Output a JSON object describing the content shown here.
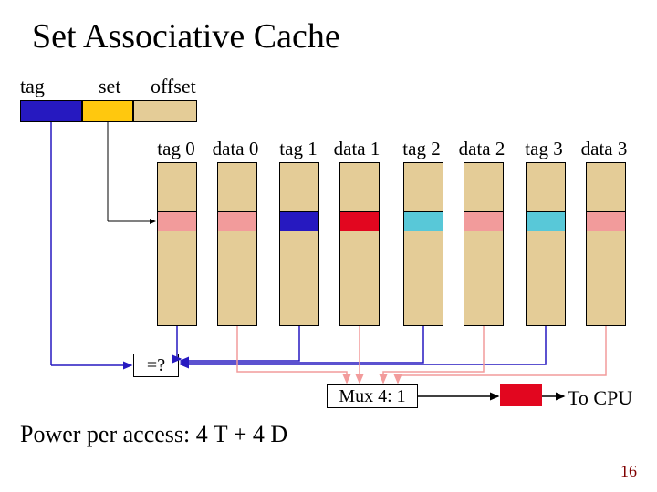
{
  "title": "Set Associative Cache",
  "addr": {
    "tag": "tag",
    "set": "set",
    "offset": "offset"
  },
  "cols": {
    "tag0": "tag 0",
    "data0": "data 0",
    "tag1": "tag 1",
    "data1": "data 1",
    "tag2": "tag 2",
    "data2": "data 2",
    "tag3": "tag 3",
    "data3": "data 3"
  },
  "comparator": "=?",
  "mux": "Mux 4: 1",
  "tocpu": "To CPU",
  "power": "Power per access: 4 T + 4 D",
  "slidenum": "16",
  "colors": {
    "blue": "#2619c0",
    "orange": "#ffc80e",
    "tan": "#e4cc97",
    "pink": "#f29b9b",
    "cyan": "#58c8d8",
    "red": "#e2061f",
    "darkblue": "#2619c0",
    "tagwire": "#2619c0",
    "datawire": "#f29b9b",
    "setwire": "#000"
  },
  "chart_data": {
    "type": "diagram",
    "address_fields": [
      "tag",
      "set",
      "offset"
    ],
    "ways": 4,
    "columns": [
      "tag0",
      "data0",
      "tag1",
      "data1",
      "tag2",
      "data2",
      "tag3",
      "data3"
    ],
    "selected_row_colors": {
      "tag0": "pink",
      "data0": "pink",
      "tag1": "darkblue",
      "data1": "red",
      "tag2": "cyan",
      "data2": "pink",
      "tag3": "cyan",
      "data3": "pink"
    },
    "comparator_inputs": [
      "tag",
      "tag0",
      "tag1",
      "tag2",
      "tag3"
    ],
    "mux_inputs": [
      "data0",
      "data1",
      "data2",
      "data3"
    ],
    "mux_output": "To CPU",
    "power_formula": "4T + 4D"
  }
}
